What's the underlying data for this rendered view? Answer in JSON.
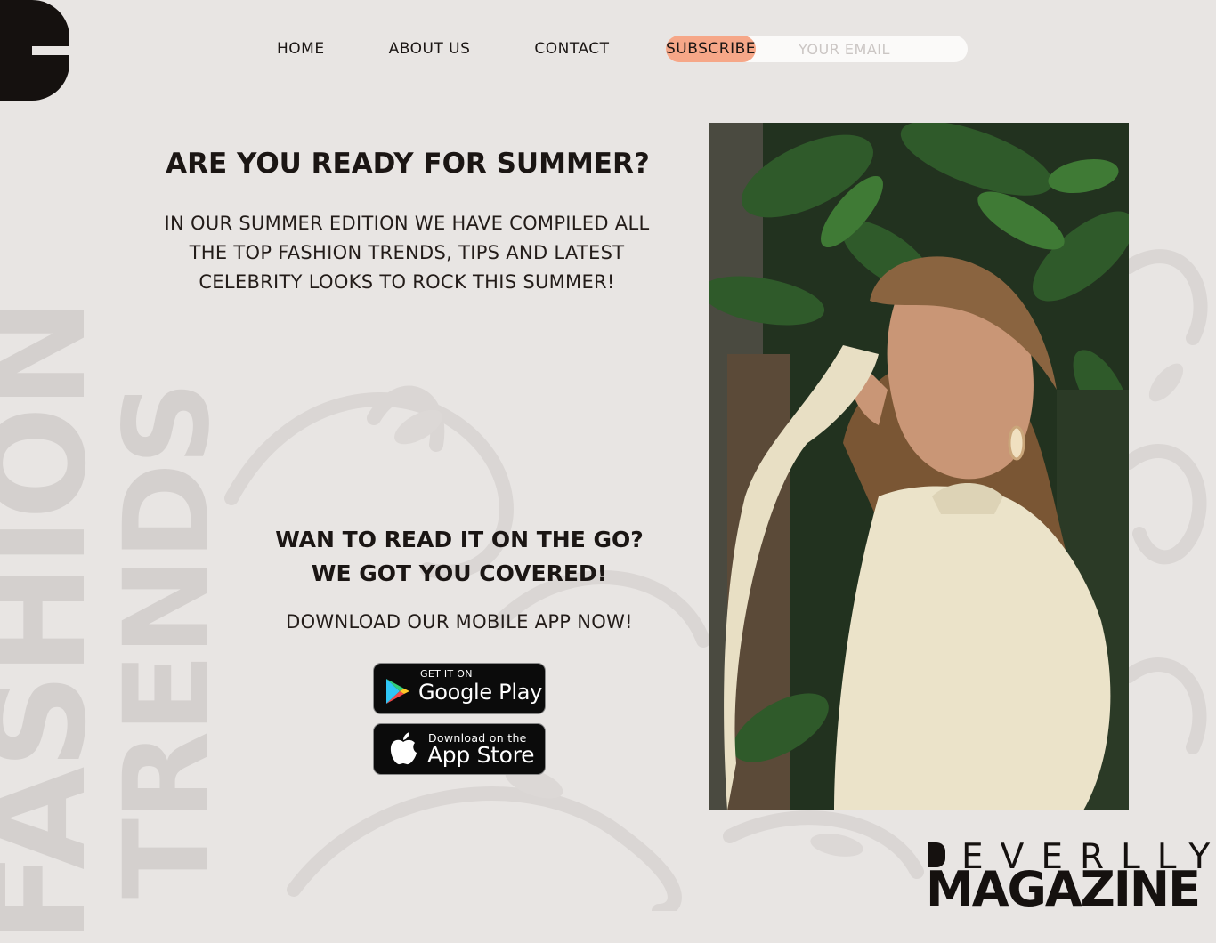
{
  "nav": {
    "items": [
      "HOME",
      "ABOUT US",
      "CONTACT"
    ]
  },
  "subscribe": {
    "button_label": "SUBSCRIBE",
    "email_placeholder": "YOUR EMAIL"
  },
  "side_text": {
    "line1": "FASHION",
    "line2": "TRENDS"
  },
  "hero": {
    "headline": "ARE YOU READY FOR SUMMER?",
    "intro": "IN OUR SUMMER EDITION WE HAVE COMPILED ALL THE TOP FASHION TRENDS, TIPS AND LATEST CELEBRITY LOOKS TO ROCK THIS SUMMER!"
  },
  "app": {
    "line1": "WAN TO READ IT ON THE GO?",
    "line2": "WE GOT YOU COVERED!",
    "download": "DOWNLOAD OUR MOBILE APP NOW!",
    "google_small": "GET IT ON",
    "google_big": "Google Play",
    "apple_small": "Download on the",
    "apple_big": "App Store"
  },
  "brand": {
    "top": "EVERLLY",
    "bottom": "MAGAZINE"
  },
  "colors": {
    "background": "#e8e5e3",
    "accent": "#f6a788",
    "ink": "#15110f"
  },
  "icons": [
    "google-play-icon",
    "apple-icon"
  ]
}
